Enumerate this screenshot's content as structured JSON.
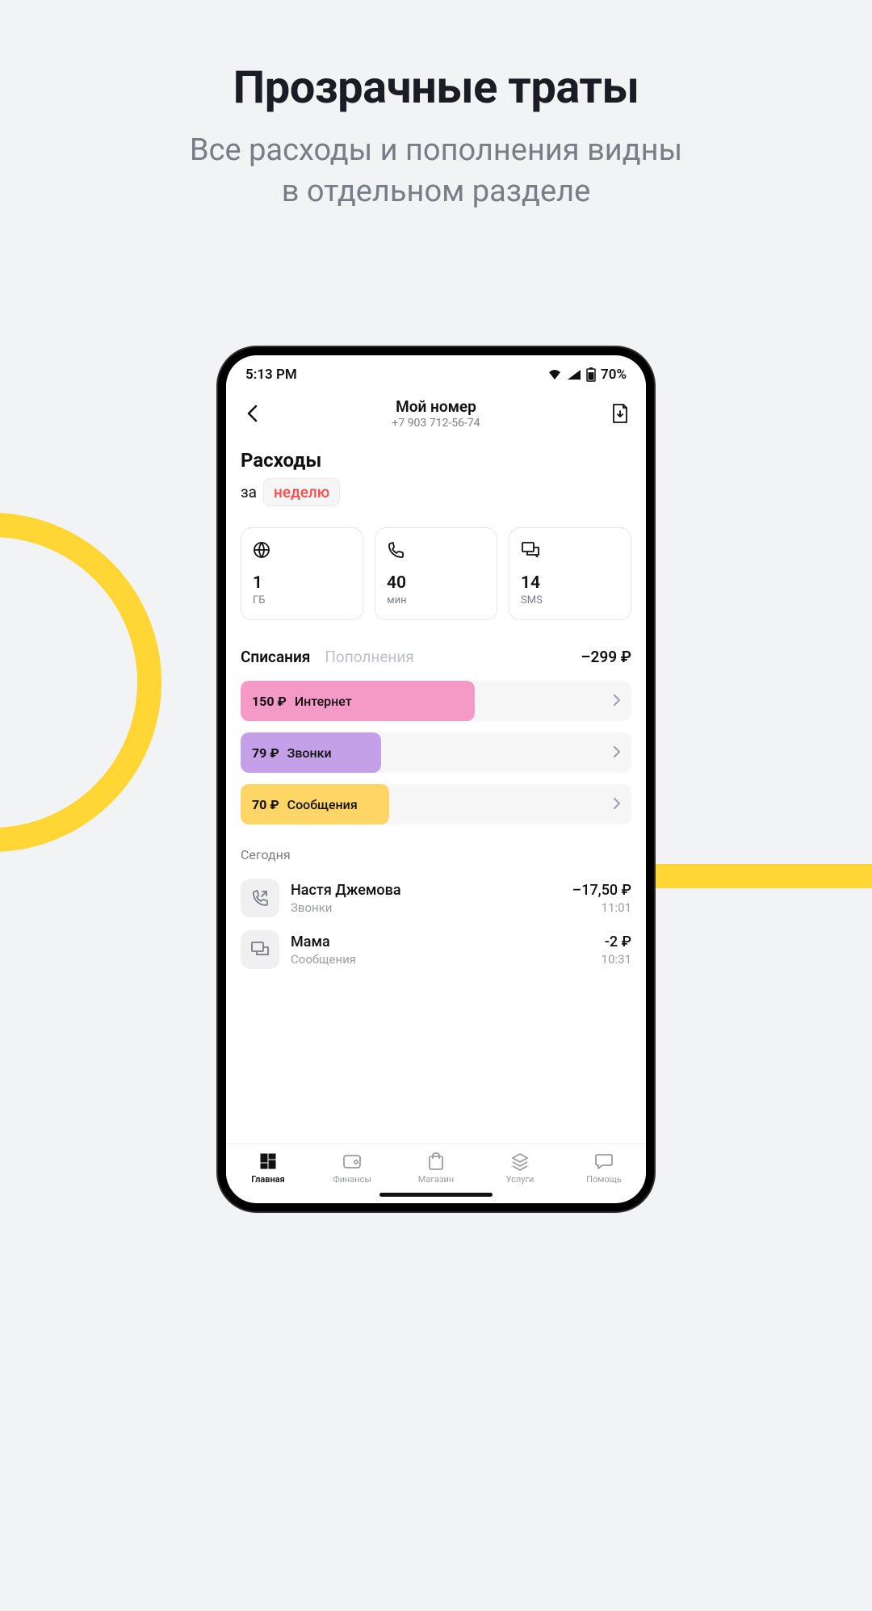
{
  "promo": {
    "title": "Прозрачные траты",
    "subtitle1": "Все расходы и пополнения видны",
    "subtitle2": "в отдельном разделе"
  },
  "status": {
    "time": "5:13 PM",
    "battery": "70%"
  },
  "header": {
    "title": "Мой номер",
    "phone": "+7 903 712-56-74"
  },
  "expenses": {
    "title": "Расходы",
    "period_prefix": "за",
    "period": "неделю"
  },
  "usage": [
    {
      "icon": "globe",
      "value": "1",
      "unit": "ГБ"
    },
    {
      "icon": "phone",
      "value": "40",
      "unit": "мин"
    },
    {
      "icon": "sms",
      "value": "14",
      "unit": "SMS"
    }
  ],
  "tabs": {
    "active": "Списания",
    "inactive": "Пополнения",
    "amount": "–299 ₽"
  },
  "bars": [
    {
      "amount": "150 ₽",
      "label": "Интернет",
      "width": "60%",
      "color": "pink"
    },
    {
      "amount": "79 ₽",
      "label": "Звонки",
      "width": "36%",
      "color": "purple"
    },
    {
      "amount": "70 ₽",
      "label": "Сообщения",
      "width": "38%",
      "color": "yellow"
    }
  ],
  "today_label": "Сегодня",
  "transactions": [
    {
      "icon": "call-out",
      "name": "Настя Джемова",
      "category": "Звонки",
      "amount": "–17,50 ₽",
      "time": "11:01"
    },
    {
      "icon": "sms",
      "name": "Мама",
      "category": "Сообщения",
      "amount": "-2 ₽",
      "time": "10:31"
    }
  ],
  "nav": [
    {
      "label": "Главная",
      "active": true
    },
    {
      "label": "Финансы",
      "active": false
    },
    {
      "label": "Магазин",
      "active": false
    },
    {
      "label": "Услуги",
      "active": false
    },
    {
      "label": "Помощь",
      "active": false
    }
  ]
}
